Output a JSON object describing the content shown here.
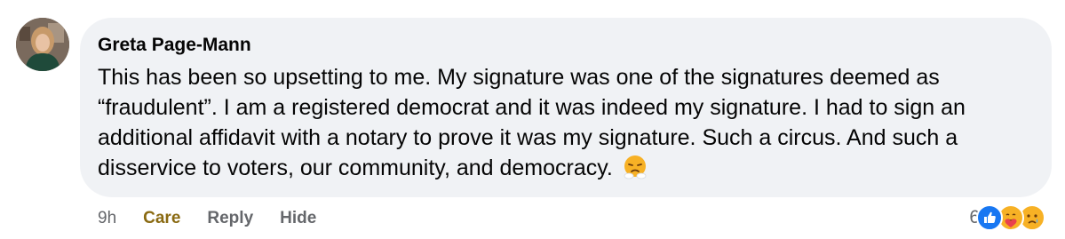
{
  "comment": {
    "author": "Greta Page-Mann",
    "text": "This has been so upsetting to me. My signature was one of the signatures deemed as “fraudulent”. I am a registered democrat and it was indeed my signature. I had to sign an additional affidavit with a notary to prove it was my signature. Such a circus. And such a disservice to voters, our community, and democracy.",
    "emoji": "steam-from-nose-emoji",
    "avatar_icon": "profile-photo"
  },
  "actions": {
    "time": "9h",
    "care_label": "Care",
    "reply_label": "Reply",
    "hide_label": "Hide"
  },
  "reactions": {
    "count": "6",
    "icons": [
      "like-icon",
      "care-icon",
      "sad-icon"
    ]
  },
  "colors": {
    "bubble": "#f0f2f5",
    "text": "#050505",
    "secondary": "#65676b",
    "care": "#8a6a12",
    "like": "#1877f2",
    "emoji": "#f7b125"
  }
}
